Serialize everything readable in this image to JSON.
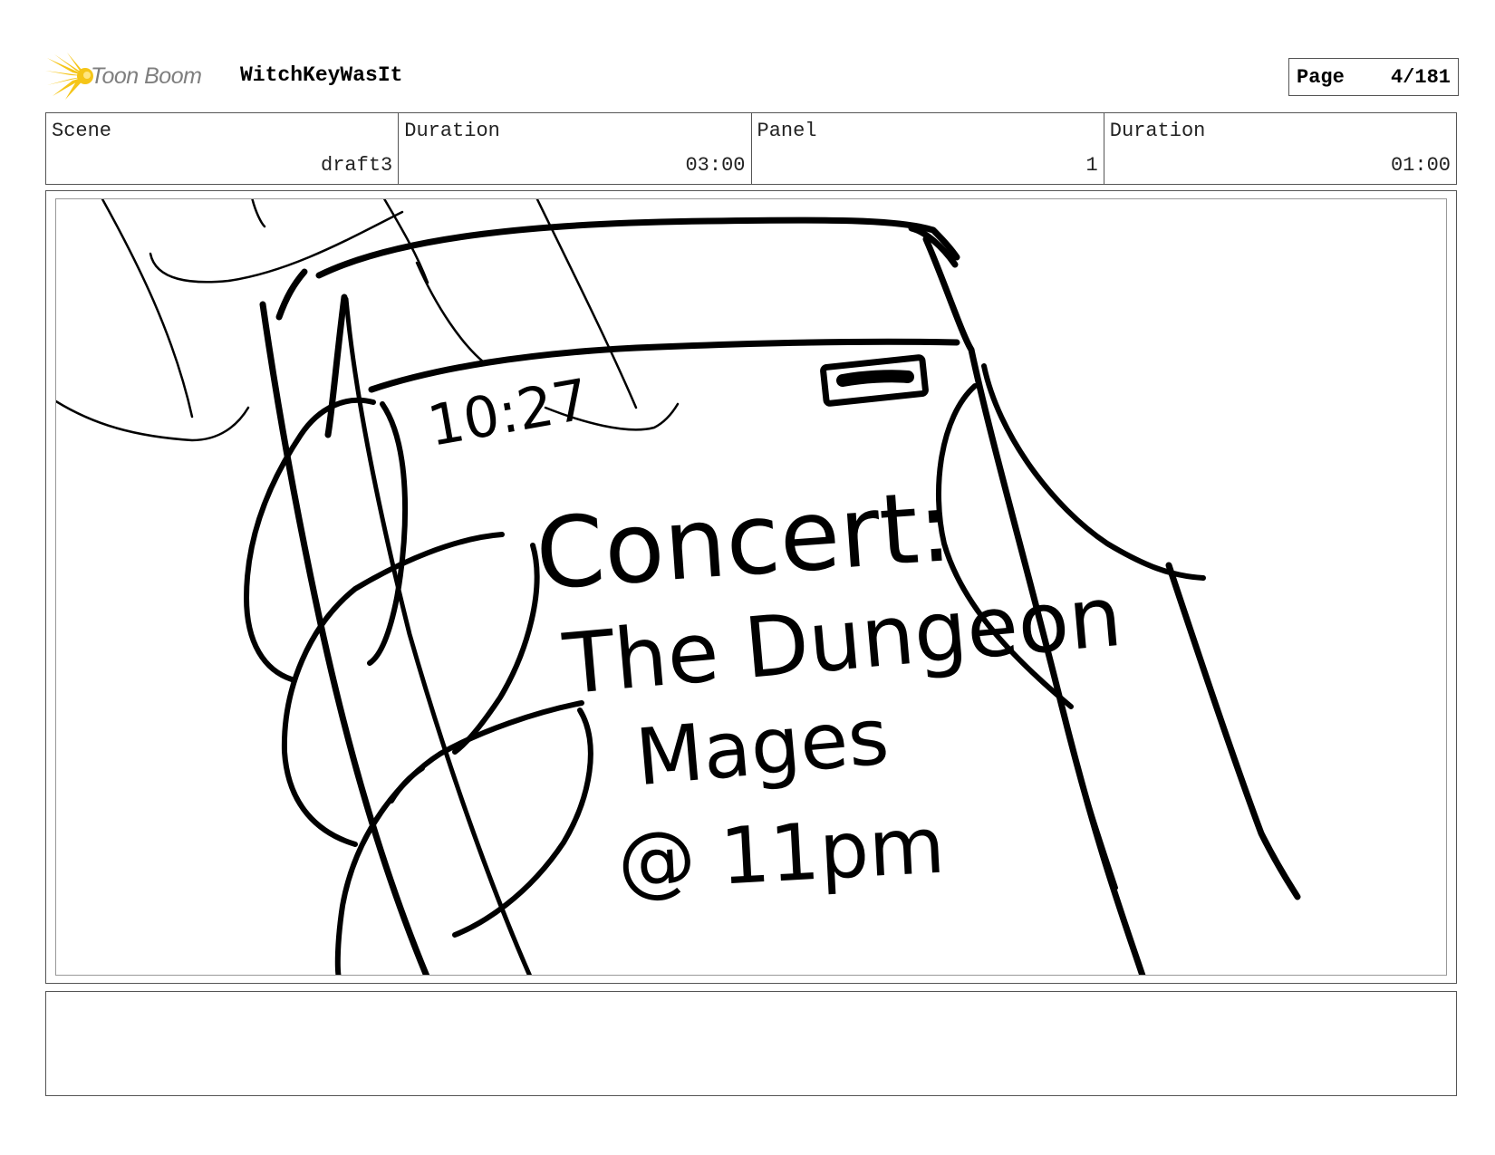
{
  "header": {
    "logo_text": "Toon Boom",
    "project_title": "WitchKeyWasIt",
    "page_label": "Page",
    "page_number": "4/181"
  },
  "info": {
    "scene_label": "Scene",
    "scene_value": "draft3",
    "scene_duration_label": "Duration",
    "scene_duration_value": "03:00",
    "panel_label": "Panel",
    "panel_value": "1",
    "panel_duration_label": "Duration",
    "panel_duration_value": "01:00"
  },
  "sketch": {
    "time_text": "10:27",
    "line1": "Concert:",
    "line2": "The Dungeon",
    "line3": "Mages",
    "line4": "@ 11pm"
  },
  "notes": {
    "text": ""
  },
  "colors": {
    "logo_yellow": "#f5c518",
    "logo_gray": "#7f7f7f",
    "border": "#555555"
  }
}
